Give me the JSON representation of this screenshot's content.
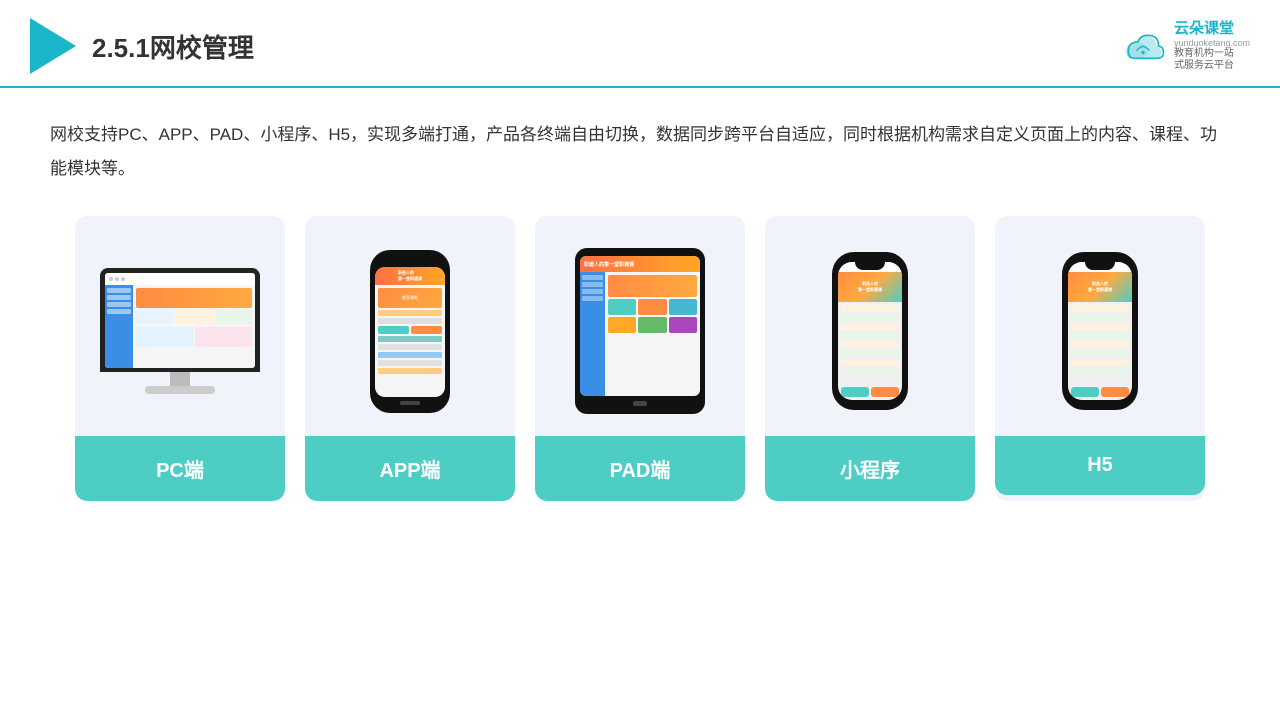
{
  "header": {
    "title": "2.5.1网校管理",
    "brand_name": "云朵课堂",
    "brand_url": "yunduoketang.com",
    "brand_slogan": "教育机构一站\n式服务云平台"
  },
  "description": "网校支持PC、APP、PAD、小程序、H5，实现多端打通，产品各终端自由切换，数据同步跨平台自适应，同时根据机构需求自定义页面上的内容、课程、功能模块等。",
  "cards": [
    {
      "id": "pc",
      "label": "PC端"
    },
    {
      "id": "app",
      "label": "APP端"
    },
    {
      "id": "pad",
      "label": "PAD端"
    },
    {
      "id": "miniprogram",
      "label": "小程序"
    },
    {
      "id": "h5",
      "label": "H5"
    }
  ],
  "accent_color": "#4ecdc4"
}
